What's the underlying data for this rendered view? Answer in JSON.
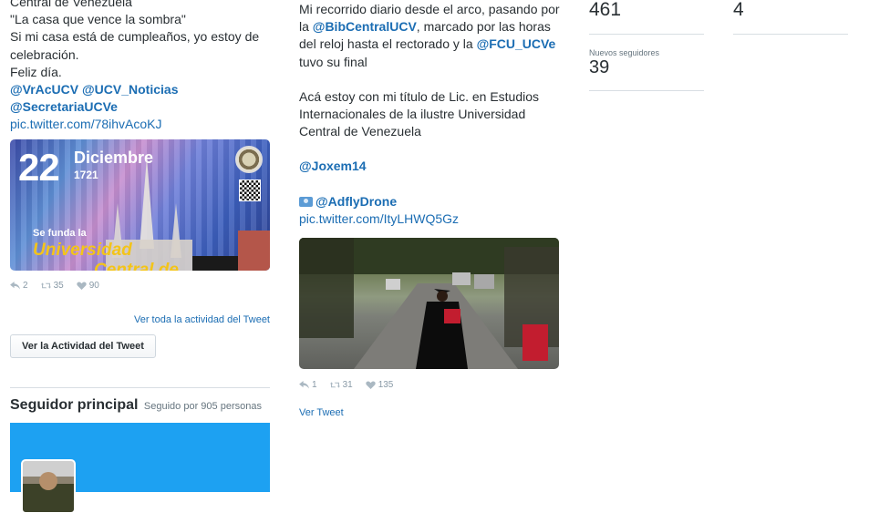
{
  "col1": {
    "tweet_lines": [
      "Central de Venezuela",
      "\"La casa que vence la sombra\"",
      "Si mi casa está de cumpleaños, yo estoy de celebración.",
      "Feliz día."
    ],
    "mentions_line1": [
      "@VrAcUCV",
      "@UCV_Noticias"
    ],
    "mention_line2": "@SecretariaUCVe",
    "pic_url": "pic.twitter.com/78ihvAcoKJ",
    "image": {
      "day": "22",
      "month": "Diciembre",
      "year": "1721",
      "caption_small": "Se funda la",
      "caption_big": "Universidad",
      "caption_cut": "Central de"
    },
    "actions": {
      "replies": "2",
      "retweets": "35",
      "likes": "90"
    },
    "activity_link": "Ver toda la actividad del Tweet",
    "activity_button": "Ver la Actividad del Tweet",
    "top_follower": {
      "title": "Seguidor principal",
      "followed_by": "Seguido por 905 personas"
    }
  },
  "col2": {
    "text_before_m1": "Mi recorrido diario desde el arco, pasando por la ",
    "mention1": "@BibCentralUCV",
    "text_after_m1": ", marcado por las horas del reloj hasta el rectorado y la ",
    "mention2": "@FCU_UCVe",
    "text_after_m2": " tuvo su final",
    "paragraph2": "Acá estoy con mi título de Lic. en Estudios Internacionales de la ilustre Universidad Central de Venezuela",
    "mention3": "@Joxem14",
    "mention4": "@AdflyDrone",
    "pic_url": "pic.twitter.com/ItyLHWQ5Gz",
    "actions": {
      "replies": "1",
      "retweets": "31",
      "likes": "135"
    },
    "view_tweet": "Ver Tweet"
  },
  "col3": {
    "stat_a_value": "461",
    "stat_b_value": "4",
    "stat_c_label": "Nuevos seguidores",
    "stat_c_value": "39"
  },
  "icons": [
    "reply-icon",
    "retweet-icon",
    "heart-icon",
    "camera-icon"
  ],
  "colors": {
    "link": "#1b6db3",
    "text": "#292f33",
    "muted": "#8899a6",
    "banner": "#1da1f2"
  }
}
